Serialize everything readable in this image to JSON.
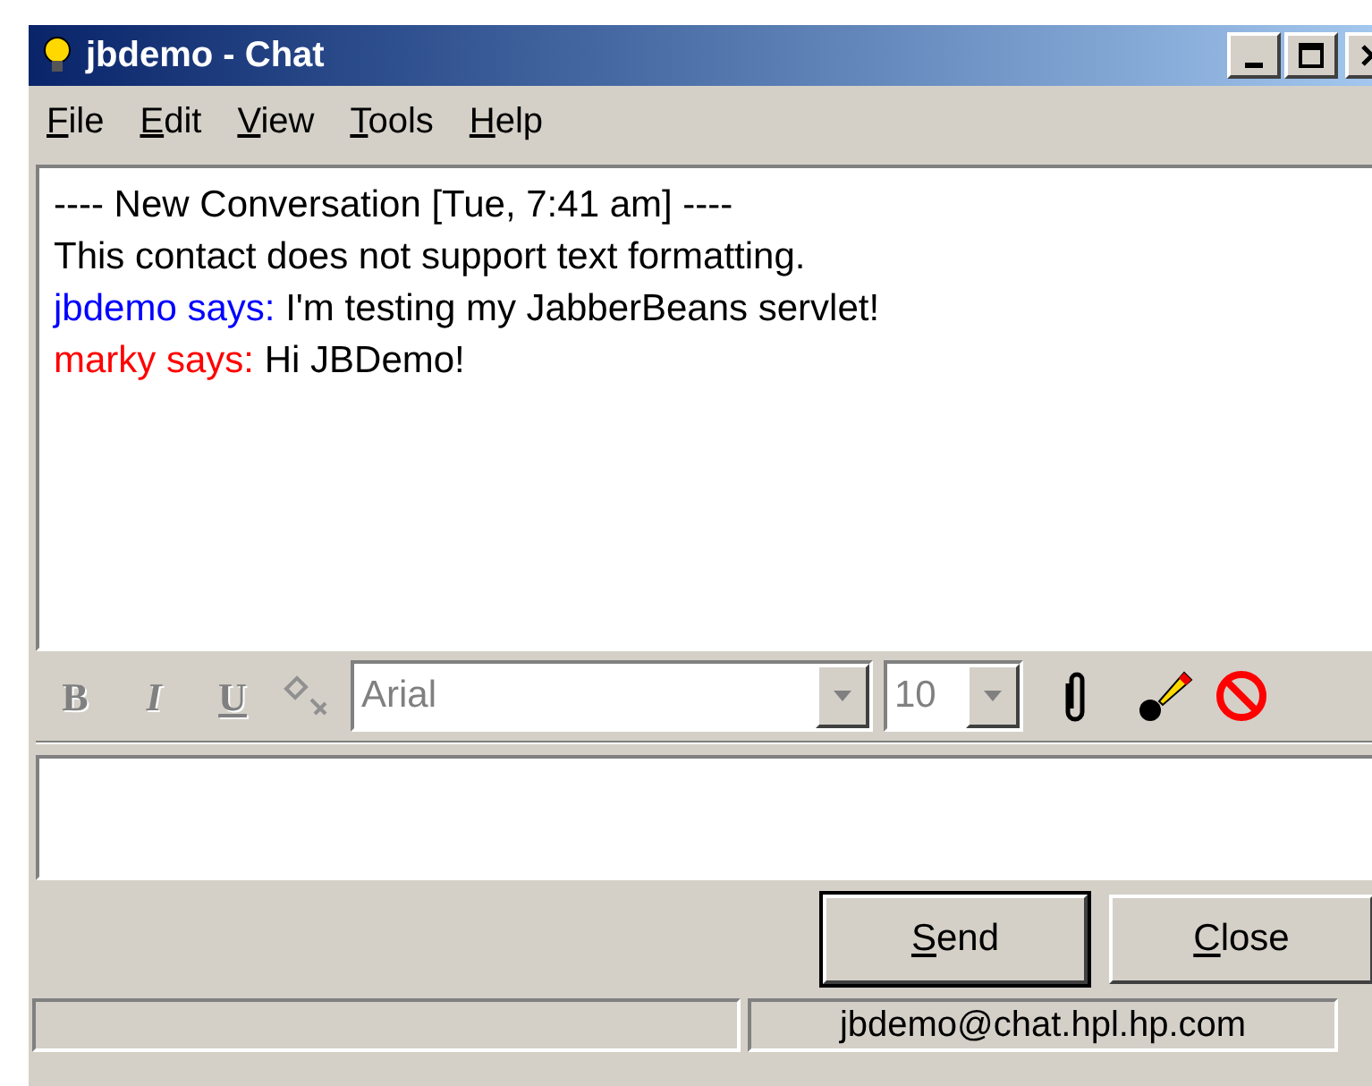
{
  "window": {
    "title": "jbdemo - Chat"
  },
  "menu": [
    {
      "label": "File"
    },
    {
      "label": "Edit"
    },
    {
      "label": "View"
    },
    {
      "label": "Tools"
    },
    {
      "label": "Help"
    }
  ],
  "conversation": [
    {
      "kind": "system",
      "text": "---- New Conversation [Tue, 7:41 am] ----"
    },
    {
      "kind": "system",
      "text": "This contact does not support text formatting."
    },
    {
      "kind": "message",
      "speaker": "jbdemo says:",
      "color": "#0000ff",
      "text": "I'm testing my JabberBeans servlet!"
    },
    {
      "kind": "message",
      "speaker": "marky says:",
      "color": "#ff0000",
      "text": "Hi JBDemo!"
    }
  ],
  "format_toolbar": {
    "bold": {
      "label": "B",
      "disabled": true
    },
    "italic": {
      "label": "I",
      "disabled": true
    },
    "underline": {
      "label": "U",
      "disabled": true
    },
    "link_disabled": true,
    "font": {
      "value": "Arial",
      "disabled": true
    },
    "size": {
      "value": "10",
      "disabled": true
    }
  },
  "buttons": [
    {
      "label": "Send",
      "default": true
    },
    {
      "label": "Close",
      "default": false
    }
  ],
  "status_bar": {
    "account": "jbdemo@chat.hpl.hp.com"
  }
}
